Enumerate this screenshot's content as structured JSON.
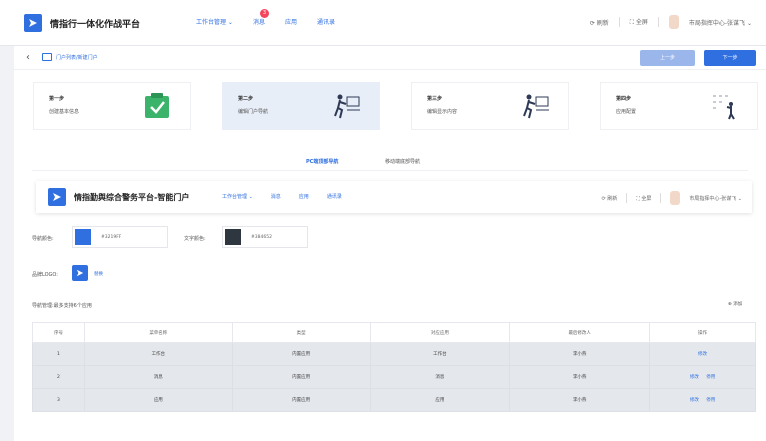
{
  "header": {
    "app_title": "情指行一体化作战平台",
    "nav": [
      "工作台管理 ⌄",
      "消息",
      "应用",
      "通讯录"
    ],
    "badge": "3",
    "refresh": "刷新",
    "fullscreen": "全屏",
    "user": "市局指挥中心-张谋飞 ⌄"
  },
  "breadcrumb": {
    "text": "门户列表/新建门户"
  },
  "actions": {
    "prev": "上一步",
    "next": "下一步"
  },
  "steps": [
    {
      "title": "第一步",
      "desc": "创建基本信息"
    },
    {
      "title": "第二步",
      "desc": "编辑门户导航"
    },
    {
      "title": "第三步",
      "desc": "编辑显示内容"
    },
    {
      "title": "第四步",
      "desc": "应用配置"
    }
  ],
  "subtabs": {
    "pc": "PC端顶部导航",
    "mobile": "移动端底部导航"
  },
  "preview": {
    "title": "情指勤舆综合警务平台-智能门户",
    "nav": [
      "工作台管理 ⌄",
      "消息",
      "应用",
      "通讯录"
    ],
    "refresh": "刷新",
    "fullscreen": "全屏",
    "user": "市局指挥中心-张谋飞 ⌄"
  },
  "settings": {
    "nav_color_label": "导航颜色:",
    "nav_color": "#2F6FE0",
    "nav_color_hex": "#3219FF",
    "text_color_label": "文字颜色:",
    "text_color": "#2E3640",
    "text_color_hex": "#384652",
    "brand_label": "品牌LOGO:",
    "brand_replace": "替换",
    "nav_manage_label": "导航管理:最多支持6个应用",
    "add": "添加"
  },
  "table": {
    "headers": [
      "序号",
      "菜单名称",
      "类型",
      "对应应用",
      "最后修改人",
      "操作"
    ],
    "rows": [
      {
        "index": "1",
        "name": "工作台",
        "type": "内置应用",
        "app": "工作台",
        "editor": "李小燕",
        "ops": [
          "修改"
        ]
      },
      {
        "index": "2",
        "name": "消息",
        "type": "内置应用",
        "app": "消息",
        "editor": "李小燕",
        "ops": [
          "修改",
          "停用"
        ]
      },
      {
        "index": "3",
        "name": "应用",
        "type": "内置应用",
        "app": "应用",
        "editor": "李小燕",
        "ops": [
          "修改",
          "停用"
        ]
      }
    ]
  },
  "colors": {
    "accent": "#2F6FE0",
    "badge": "#F5455C"
  }
}
